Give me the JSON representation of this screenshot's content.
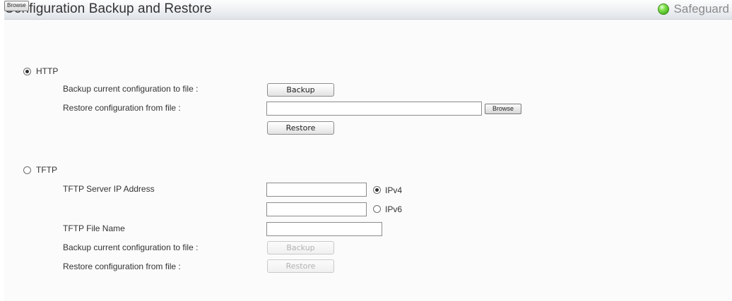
{
  "header": {
    "title": "Configuration Backup and Restore",
    "browse_overlay": "Browse",
    "safeguard_label": "Safeguard",
    "safeguard_status_color": "#4ccc1f"
  },
  "http": {
    "label": "HTTP",
    "selected": true,
    "backup_label": "Backup current configuration to file :",
    "backup_button": "Backup",
    "restore_label": "Restore configuration from file :",
    "restore_file_value": "",
    "browse_button": "Browse",
    "restore_button": "Restore"
  },
  "tftp": {
    "label": "TFTP",
    "selected": false,
    "server_ip_label": "TFTP Server IP Address",
    "ipv4_value": "",
    "ipv4_label": "IPv4",
    "ipv4_selected": true,
    "ipv6_value": "",
    "ipv6_label": "IPv6",
    "ipv6_selected": false,
    "file_name_label": "TFTP File Name",
    "file_name_value": "",
    "backup_label": "Backup current configuration to file :",
    "backup_button": "Backup",
    "restore_label": "Restore configuration from file :",
    "restore_button": "Restore"
  }
}
